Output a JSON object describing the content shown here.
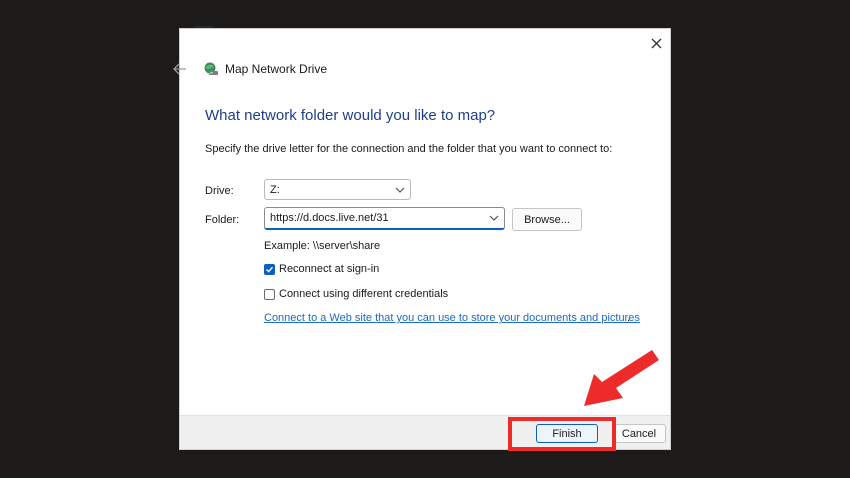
{
  "dialog": {
    "title": "Map Network Drive",
    "heading": "What network folder would you like to map?",
    "instruction": "Specify the drive letter for the connection and the folder that you want to connect to:",
    "icons": {
      "back": "back-arrow-icon",
      "close": "close-icon",
      "title": "network-drive-icon"
    }
  },
  "form": {
    "drive_label": "Drive:",
    "drive_value": "Z:",
    "folder_label": "Folder:",
    "folder_value": "https://d.docs.live.net/31",
    "browse_label": "Browse...",
    "example_text": "Example: \\\\server\\share",
    "reconnect_label": "Reconnect at sign-in",
    "reconnect_checked": true,
    "credentials_label": "Connect using different credentials",
    "credentials_checked": false,
    "web_link_text": "Connect to a Web site that you can use to store your documents and pictures",
    "web_link_period": "."
  },
  "footer": {
    "finish_label": "Finish",
    "cancel_label": "Cancel"
  },
  "annotation": {
    "highlight_color": "#ee2b2b",
    "target": "finish-button"
  },
  "colors": {
    "heading": "#1e3f8a",
    "accent": "#0a5fbf",
    "link": "#1a6ac2",
    "background": "#1c1b1a"
  }
}
